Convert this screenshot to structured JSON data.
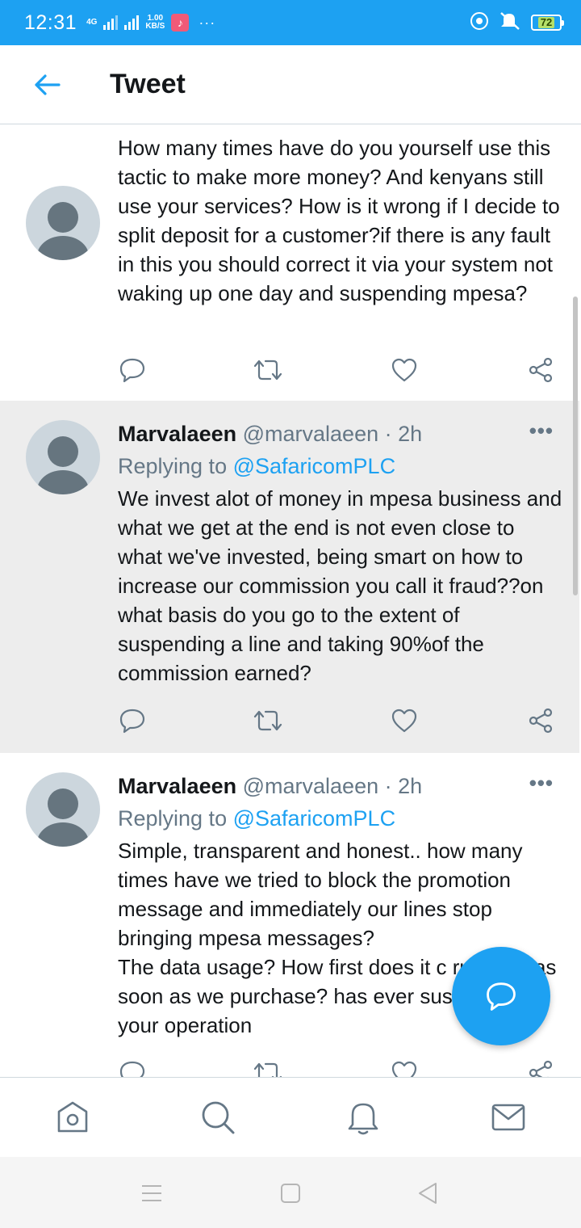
{
  "status_bar": {
    "time": "12:31",
    "network": "4G",
    "speed_value": "1.00",
    "speed_unit": "KB/S",
    "more": "···",
    "battery": "72"
  },
  "header": {
    "title": "Tweet"
  },
  "tweets": [
    {
      "text": "How many times have do you yourself use this tactic to make more money? And kenyans still use your services? How is it wrong if I decide to split deposit for a customer?if there is any fault in this you should correct it via your system not waking up one day and suspending mpesa?"
    },
    {
      "name": "Marvalaeen",
      "handle": "@marvalaeen · 2h",
      "replying_prefix": "Replying to ",
      "replying_to": "@SafaricomPLC",
      "text": "We invest alot of money in mpesa business and what we get at the end is not even close to what we've invested, being smart on how to increase our commission you call it fraud??on what basis do you go to the extent of suspending a line and taking 90%of the commission earned?"
    },
    {
      "name": "Marvalaeen",
      "handle": "@marvalaeen · 2h",
      "replying_prefix": "Replying to ",
      "replying_to": "@SafaricomPLC",
      "text": "Simple, transparent and honest.. how many times have we tried to block the promotion message and immediately our lines stop bringing mpesa messages?\nThe data usage? How first does it c runs out as soon as we purchase? has ever suspended your operation"
    }
  ],
  "more_menu": "•••",
  "colors": {
    "brand": "#1da1f2",
    "highlight_bg": "#ededed",
    "secondary_text": "#657786"
  },
  "icons": {
    "back": "arrow-left-icon",
    "reply": "reply-icon",
    "retweet": "retweet-icon",
    "like": "heart-icon",
    "share": "share-icon",
    "compose": "compose-reply-icon",
    "home": "home-icon",
    "search": "search-icon",
    "notifications": "bell-icon",
    "messages": "mail-icon"
  }
}
